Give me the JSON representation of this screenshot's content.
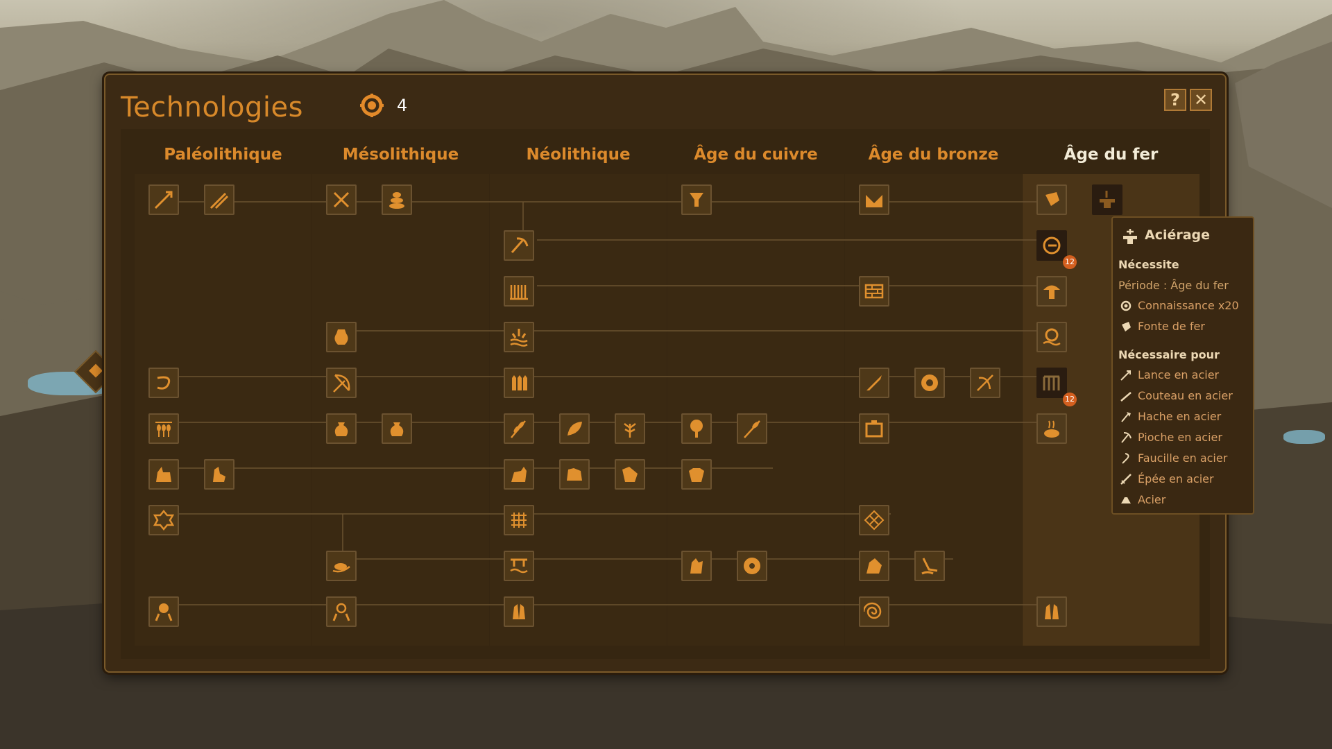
{
  "window": {
    "title": "Technologies",
    "knowledge": "4",
    "help_label": "?",
    "close_label": "✕"
  },
  "periods": [
    "Paléolithique",
    "Mésolithique",
    "Néolithique",
    "Âge du cuivre",
    "Âge du bronze",
    "Âge du fer"
  ],
  "active_period": "Âge du fer",
  "colors": {
    "accent": "#d8892a",
    "panel": "#3c2a14",
    "badge": "#d35f1f"
  },
  "badges": [
    "12",
    "12"
  ],
  "tooltip": {
    "title": "Aciérage",
    "requires_label": "Nécessite",
    "period_line": "Période : Âge du fer",
    "requires": [
      "Connaissance x20",
      "Fonte de fer"
    ],
    "required_for_label": "Nécessaire pour",
    "required_for": [
      "Lance en acier",
      "Couteau en acier",
      "Hache en acier",
      "Pioche en acier",
      "Faucille en acier",
      "Épée en acier",
      "Acier"
    ]
  },
  "icons": [
    "knowledge-icon",
    "close-icon",
    "help-icon",
    "anvil-icon",
    "spear-icon",
    "knife-icon",
    "axe-icon",
    "pickaxe-icon",
    "sickle-icon",
    "sword-icon",
    "ingot-icon"
  ]
}
